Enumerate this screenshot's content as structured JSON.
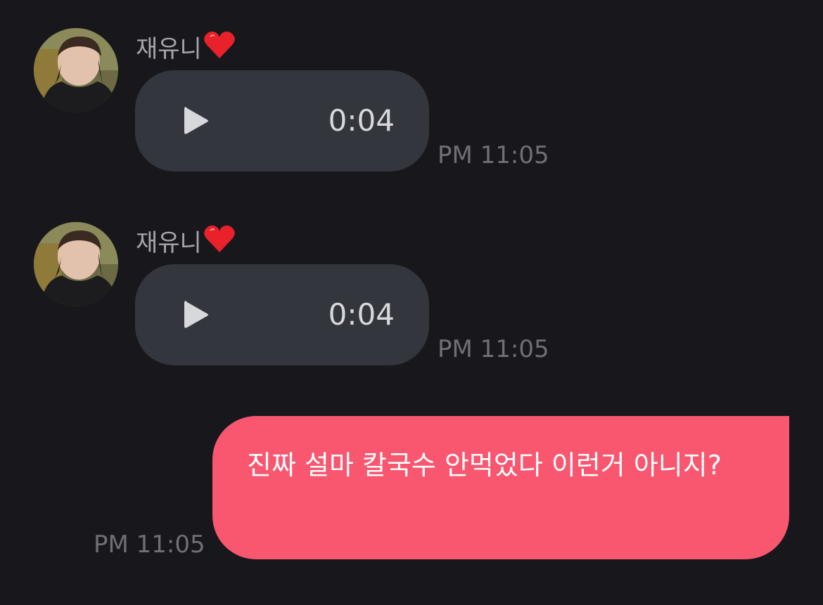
{
  "messages": [
    {
      "sender": "재유니",
      "type": "voice",
      "duration": "0:04",
      "time": "PM 11:05"
    },
    {
      "sender": "재유니",
      "type": "voice",
      "duration": "0:04",
      "time": "PM 11:05"
    },
    {
      "type": "text",
      "text": "진짜 설마 칼국수 안먹었다 이런거 아니지?",
      "time": "PM 11:05"
    }
  ],
  "colors": {
    "background": "#18181c",
    "incoming_bubble": "#34363d",
    "outgoing_bubble": "#f9566f",
    "timestamp": "#6f7076",
    "sender_name": "#a5a6ab"
  },
  "icons": {
    "heart": "heart-icon",
    "play": "play-icon",
    "avatar": "avatar"
  }
}
